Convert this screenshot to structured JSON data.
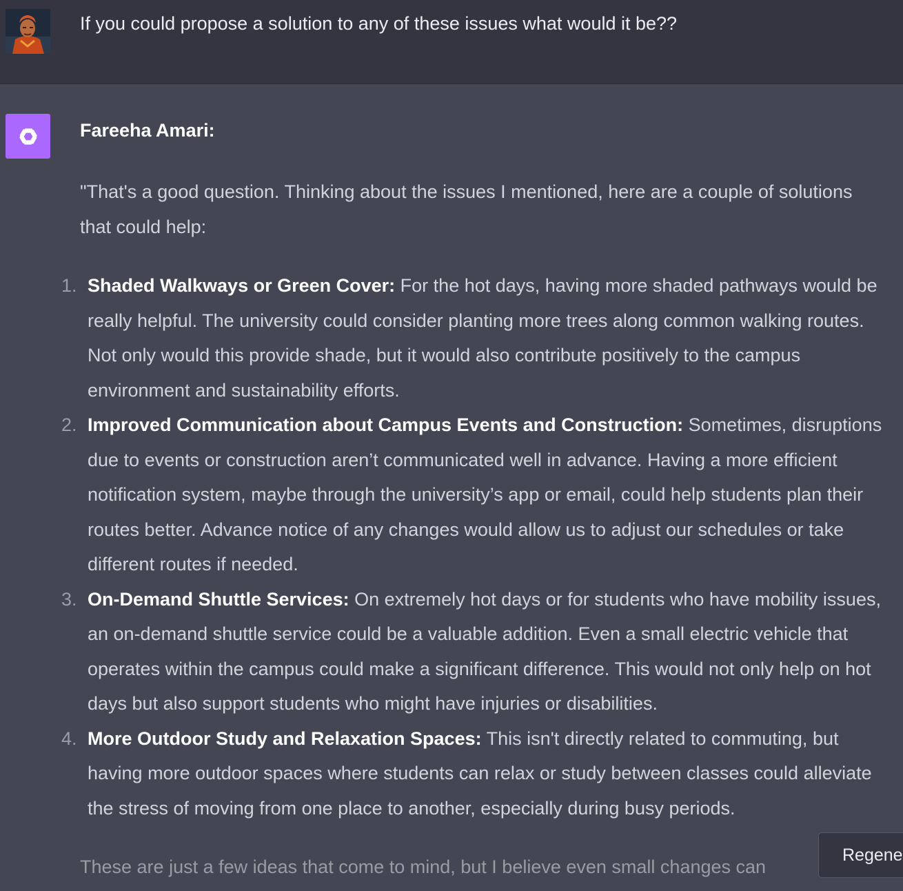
{
  "user_message": {
    "text": "If you could propose a solution to any of these issues what would it be??"
  },
  "assistant_message": {
    "speaker": "Fareeha Amari:",
    "intro": "\"That's a good question. Thinking about the issues I mentioned, here are a couple of solutions that could help:",
    "solutions": [
      {
        "number": "1.",
        "title": "Shaded Walkways or Green Cover:",
        "body": "For the hot days, having more shaded pathways would be really helpful. The university could consider planting more trees along common walking routes. Not only would this provide shade, but it would also contribute positively to the campus environment and sustainability efforts."
      },
      {
        "number": "2.",
        "title": "Improved Communication about Campus Events and Construction:",
        "body": "Sometimes, disruptions due to events or construction aren’t communicated well in advance. Having a more efficient notification system, maybe through the university’s app or email, could help students plan their routes better. Advance notice of any changes would allow us to adjust our schedules or take different routes if needed."
      },
      {
        "number": "3.",
        "title": "On-Demand Shuttle Services:",
        "body": "On extremely hot days or for students who have mobility issues, an on-demand shuttle service could be a valuable addition. Even a small electric vehicle that operates within the campus could make a significant difference. This would not only help on hot days but also support students who might have injuries or disabilities."
      },
      {
        "number": "4.",
        "title": "More Outdoor Study and Relaxation Spaces:",
        "body": "This isn't directly related to commuting, but having more outdoor spaces where students can relax or study between classes could alleviate the stress of moving from one place to another, especially during busy periods."
      }
    ],
    "closing": "These are just a few ideas that come to mind, but I believe even small changes can"
  },
  "regenerate_button": {
    "label": "Regenerate",
    "icon": "refresh-icon"
  },
  "colors": {
    "user_bg": "#343541",
    "assistant_bg": "#444654",
    "bot_avatar": "#ab68ff"
  }
}
